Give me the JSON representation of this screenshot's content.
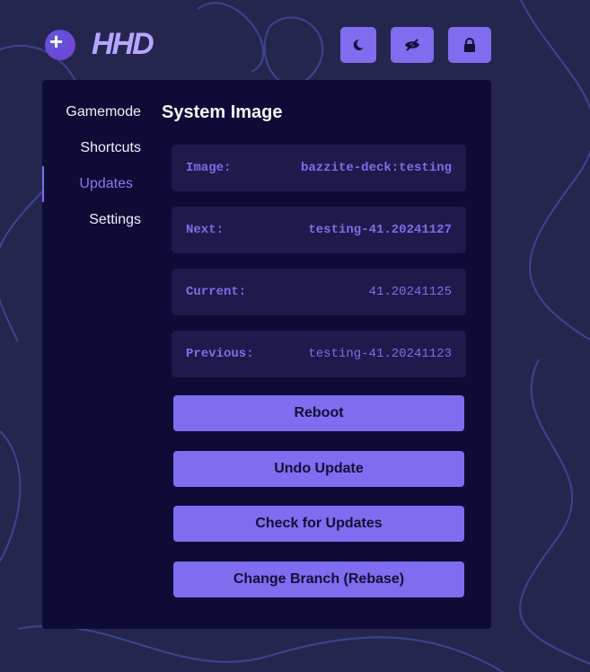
{
  "header": {
    "logo_text": "HHD"
  },
  "toolbar": [
    {
      "name": "theme-toggle-button",
      "icon": "moon-icon"
    },
    {
      "name": "hide-button",
      "icon": "eye-off-icon"
    },
    {
      "name": "lock-button",
      "icon": "lock-icon"
    }
  ],
  "sidebar": {
    "items": [
      {
        "label": "Gamemode"
      },
      {
        "label": "Shortcuts"
      },
      {
        "label": "Updates",
        "active": true
      },
      {
        "label": "Settings"
      }
    ]
  },
  "main": {
    "title": "System Image",
    "rows": [
      {
        "label": "Image:",
        "value": "bazzite-deck:testing"
      },
      {
        "label": "Next:",
        "value": "testing-41.20241127"
      },
      {
        "label": "Current:",
        "value": "41.20241125"
      },
      {
        "label": "Previous:",
        "value": "testing-41.20241123"
      }
    ],
    "buttons": [
      {
        "label": "Reboot"
      },
      {
        "label": "Undo Update"
      },
      {
        "label": "Check for Updates"
      },
      {
        "label": "Change Branch (Rebase)"
      }
    ]
  },
  "colors": {
    "accent": "#7f6cef",
    "panel": "#0e0b36",
    "background": "#25264e"
  }
}
